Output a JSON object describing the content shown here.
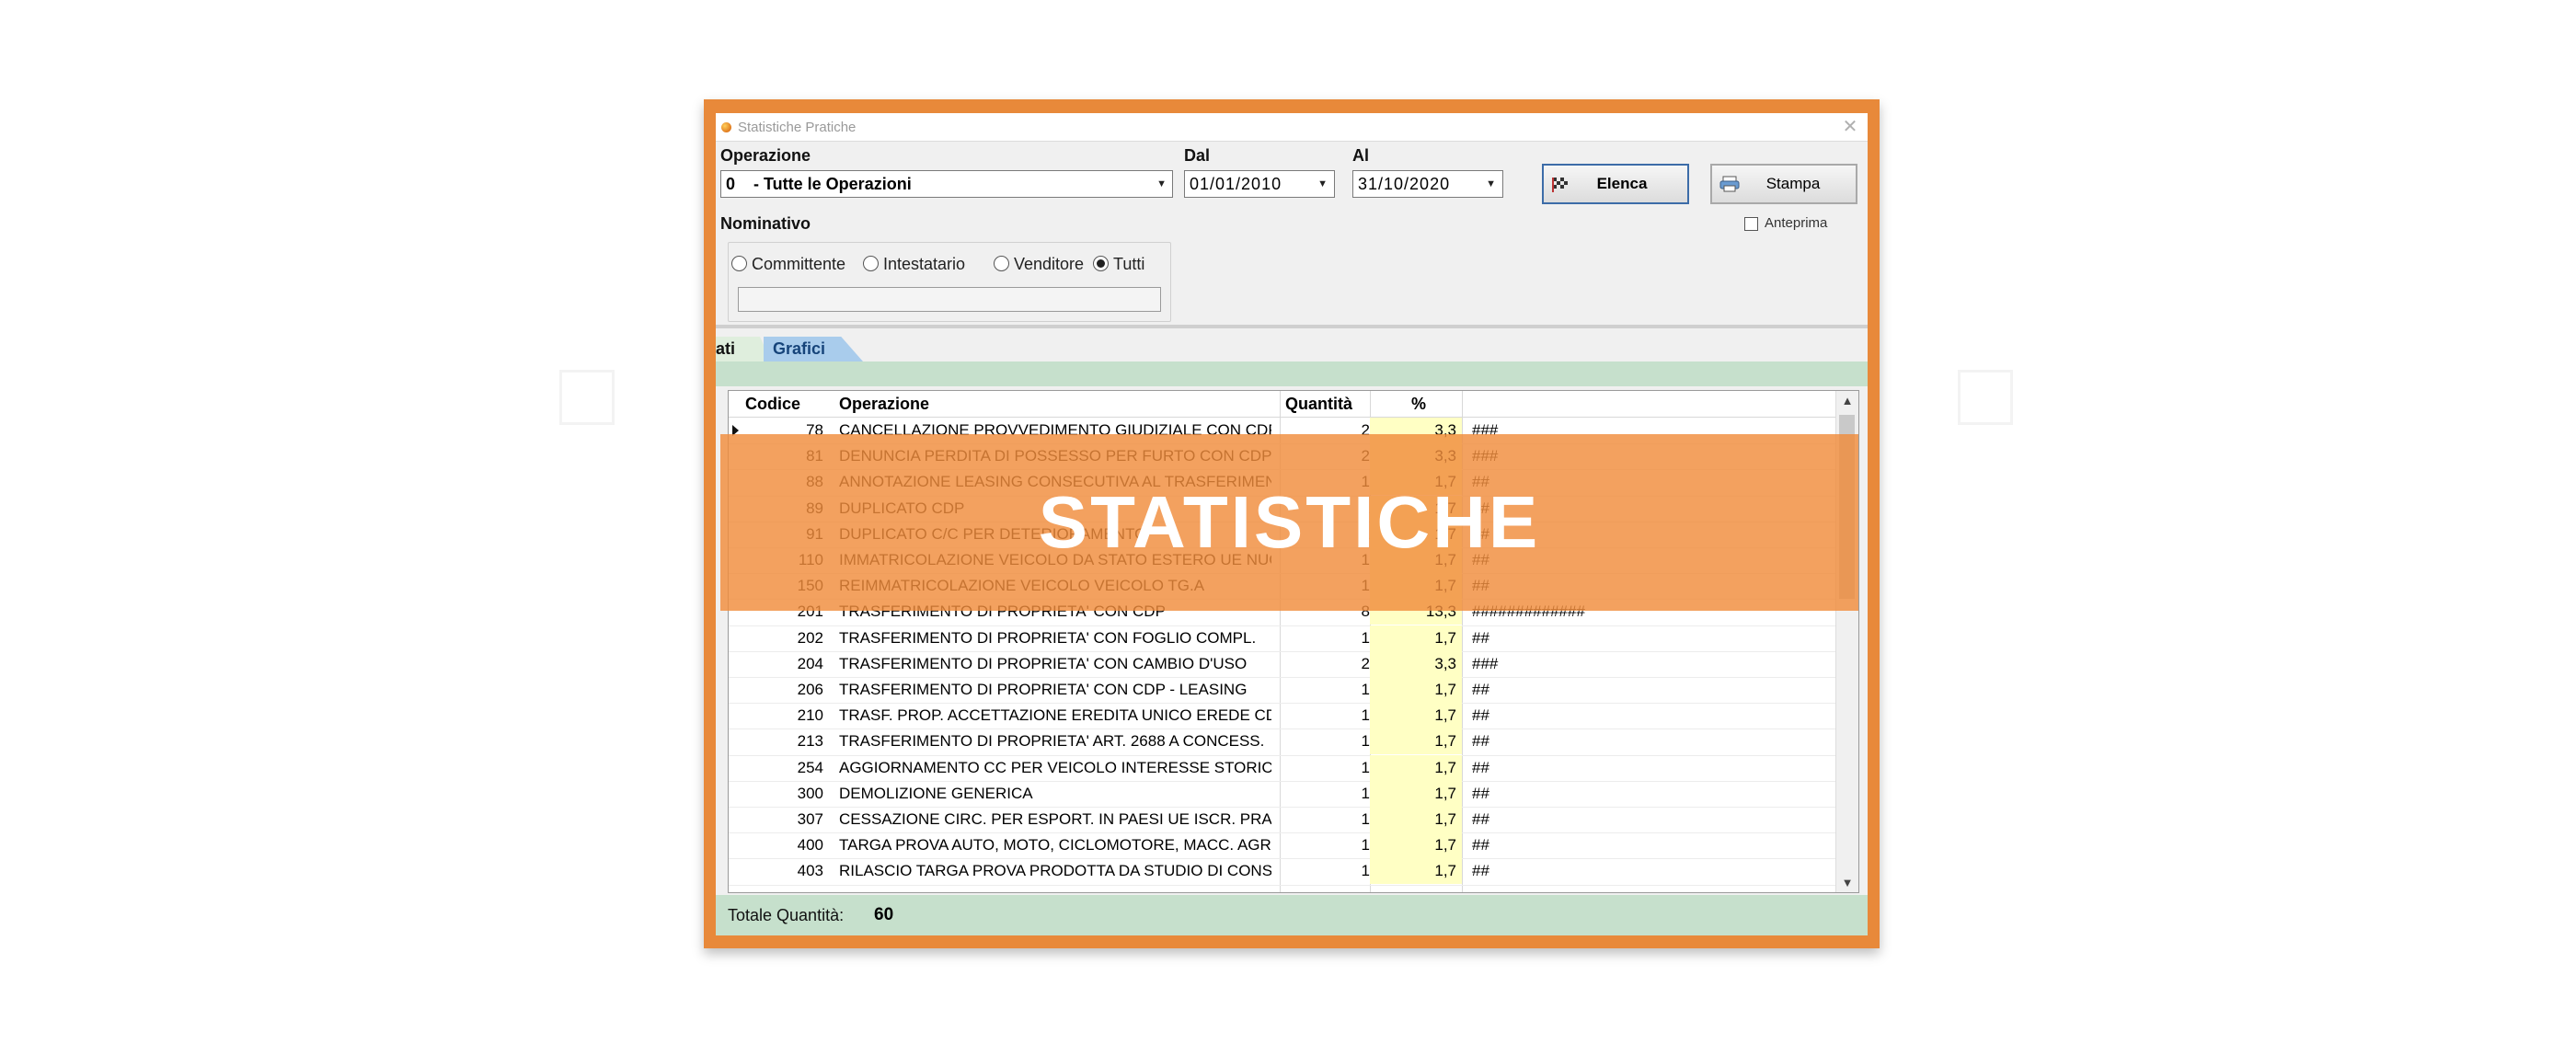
{
  "window": {
    "title": "Statistiche Pratiche",
    "close_glyph": "✕"
  },
  "filters": {
    "operazione_label": "Operazione",
    "operazione_value": "0    - Tutte le Operazioni",
    "dal_label": "Dal",
    "dal_value": "01/01/2010",
    "al_label": "Al",
    "al_value": "31/10/2020",
    "nominativo_label": "Nominativo",
    "nominativo_options": [
      "Committente",
      "Intestatario",
      "Venditore",
      "Tutti"
    ],
    "nominativo_selected": "Tutti"
  },
  "buttons": {
    "elenca": "Elenca",
    "stampa": "Stampa",
    "anteprima": "Anteprima"
  },
  "tabs": {
    "dati": "ati",
    "grafici": "Grafici"
  },
  "grid": {
    "headers": {
      "codice": "Codice",
      "operazione": "Operazione",
      "quantita": "Quantità",
      "percent": "%"
    },
    "rows": [
      {
        "codice": "78",
        "operazione": "CANCELLAZIONE PROVVEDIMENTO GIUDIZIALE CON CDP",
        "quantita": "2",
        "percent": "3,3",
        "bar": "###"
      },
      {
        "codice": "81",
        "operazione": "DENUNCIA PERDITA DI POSSESSO PER FURTO CON CDP",
        "quantita": "2",
        "percent": "3,3",
        "bar": "###"
      },
      {
        "codice": "88",
        "operazione": "ANNOTAZIONE LEASING CONSECUTIVA AL TRASFERIMENTO",
        "quantita": "1",
        "percent": "1,7",
        "bar": "##"
      },
      {
        "codice": "89",
        "operazione": "DUPLICATO CDP",
        "quantita": "1",
        "percent": "1,7",
        "bar": "##"
      },
      {
        "codice": "91",
        "operazione": "DUPLICATO C/C PER DETERIORAMENTO",
        "quantita": "1",
        "percent": "1,7",
        "bar": "##"
      },
      {
        "codice": "110",
        "operazione": "IMMATRICOLAZIONE VEICOLO DA STATO ESTERO UE NUOVO",
        "quantita": "1",
        "percent": "1,7",
        "bar": "##"
      },
      {
        "codice": "150",
        "operazione": "REIMMATRICOLAZIONE VEICOLO VEICOLO TG.A",
        "quantita": "1",
        "percent": "1,7",
        "bar": "##"
      },
      {
        "codice": "201",
        "operazione": "TRASFERIMENTO DI PROPRIETA' CON CDP",
        "quantita": "8",
        "percent": "13,3",
        "bar": "#############"
      },
      {
        "codice": "202",
        "operazione": "TRASFERIMENTO DI PROPRIETA' CON FOGLIO COMPL.",
        "quantita": "1",
        "percent": "1,7",
        "bar": "##"
      },
      {
        "codice": "204",
        "operazione": "TRASFERIMENTO DI PROPRIETA' CON CAMBIO D'USO",
        "quantita": "2",
        "percent": "3,3",
        "bar": "###"
      },
      {
        "codice": "206",
        "operazione": "TRASFERIMENTO DI PROPRIETA' CON CDP - LEASING",
        "quantita": "1",
        "percent": "1,7",
        "bar": "##"
      },
      {
        "codice": "210",
        "operazione": "TRASF. PROP. ACCETTAZIONE EREDITA UNICO EREDE CDP",
        "quantita": "1",
        "percent": "1,7",
        "bar": "##"
      },
      {
        "codice": "213",
        "operazione": "TRASFERIMENTO DI PROPRIETA' ART. 2688 A CONCESS.",
        "quantita": "1",
        "percent": "1,7",
        "bar": "##"
      },
      {
        "codice": "254",
        "operazione": "AGGIORNAMENTO CC PER VEICOLO INTERESSE STORICO",
        "quantita": "1",
        "percent": "1,7",
        "bar": "##"
      },
      {
        "codice": "300",
        "operazione": "DEMOLIZIONE GENERICA",
        "quantita": "1",
        "percent": "1,7",
        "bar": "##"
      },
      {
        "codice": "307",
        "operazione": "CESSAZIONE CIRC. PER ESPORT. IN PAESI UE ISCR. PRA",
        "quantita": "1",
        "percent": "1,7",
        "bar": "##"
      },
      {
        "codice": "400",
        "operazione": "TARGA PROVA AUTO, MOTO, CICLOMOTORE, MACC. AGRICO",
        "quantita": "1",
        "percent": "1,7",
        "bar": "##"
      },
      {
        "codice": "403",
        "operazione": "RILASCIO TARGA PROVA PRODOTTA DA STUDIO DI CONSUL.",
        "quantita": "1",
        "percent": "1,7",
        "bar": "##"
      }
    ]
  },
  "footer": {
    "label": "Totale Quantità:",
    "value": "60"
  },
  "overlay": {
    "banner_text": "STATISTICHE",
    "banner_color": "#f08c3c",
    "frame_color": "#e8893a"
  }
}
